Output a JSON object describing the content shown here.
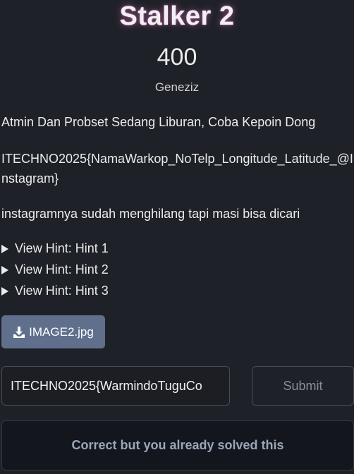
{
  "challenge": {
    "title": "Stalker 2",
    "points": "400",
    "category": "Geneziz"
  },
  "description": {
    "line1": "Atmin Dan Probset Sedang Liburan, Coba Kepoin Dong",
    "flag_format": "ITECHNO2025{NamaWarkop_NoTelp_Longitude_Latitude_@Instagram}",
    "note": "instagramnya sudah menghilang tapi masi bisa dicari"
  },
  "hints": [
    {
      "label": "View Hint: Hint 1"
    },
    {
      "label": "View Hint: Hint 2"
    },
    {
      "label": "View Hint: Hint 3"
    }
  ],
  "file": {
    "icon": "download-icon",
    "label": "IMAGE2.jpg"
  },
  "flag_input": {
    "value": "ITECHNO2025{WarmindoTuguCo"
  },
  "submit": {
    "label": "Submit"
  },
  "result": {
    "message": "Correct but you already solved this"
  },
  "colors": {
    "background": "#1f2128",
    "file_button": "#5f6f8c",
    "result_text": "#9aa7ba",
    "title_glow": "#e678c8"
  }
}
